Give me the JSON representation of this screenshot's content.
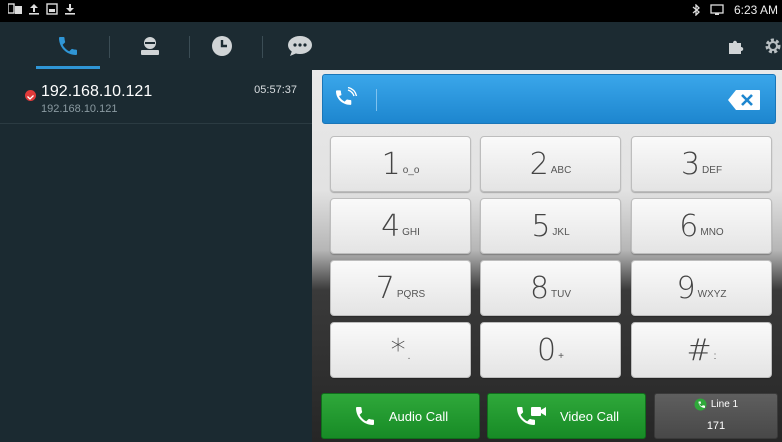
{
  "status": {
    "time": "6:23 AM",
    "icons_left": [
      "app-notification-icon",
      "upload-icon",
      "screenshot-icon",
      "download-icon"
    ],
    "icons_right": [
      "bluetooth-icon",
      "screen-cast-icon"
    ]
  },
  "nav": {
    "tabs": [
      {
        "name": "dialer",
        "icon": "phone-icon",
        "active": true
      },
      {
        "name": "contacts",
        "icon": "contact-icon",
        "active": false
      },
      {
        "name": "history",
        "icon": "clock-icon",
        "active": false
      },
      {
        "name": "messages",
        "icon": "chat-icon",
        "active": false
      }
    ],
    "right_icons": [
      "puzzle-icon",
      "gear-icon"
    ],
    "accent": "#2f96d6"
  },
  "call_list": [
    {
      "name": "192.168.10.121",
      "sub": "192.168.10.121",
      "time": "05:57:37",
      "status_color": "#e03a3a"
    }
  ],
  "dial_input": {
    "value": ""
  },
  "keypad": [
    {
      "digit": "1",
      "letters": "o_o"
    },
    {
      "digit": "2",
      "letters": "ABC"
    },
    {
      "digit": "3",
      "letters": "DEF"
    },
    {
      "digit": "4",
      "letters": "GHI"
    },
    {
      "digit": "5",
      "letters": "JKL"
    },
    {
      "digit": "6",
      "letters": "MNO"
    },
    {
      "digit": "7",
      "letters": "PQRS"
    },
    {
      "digit": "8",
      "letters": "TUV"
    },
    {
      "digit": "9",
      "letters": "WXYZ"
    },
    {
      "digit": "*",
      "letters": "."
    },
    {
      "digit": "0",
      "letters": "+"
    },
    {
      "digit": "#",
      "letters": ":"
    }
  ],
  "actions": {
    "audio_call": "Audio Call",
    "video_call": "Video Call",
    "line_label": "Line 1",
    "line_number": "171"
  }
}
